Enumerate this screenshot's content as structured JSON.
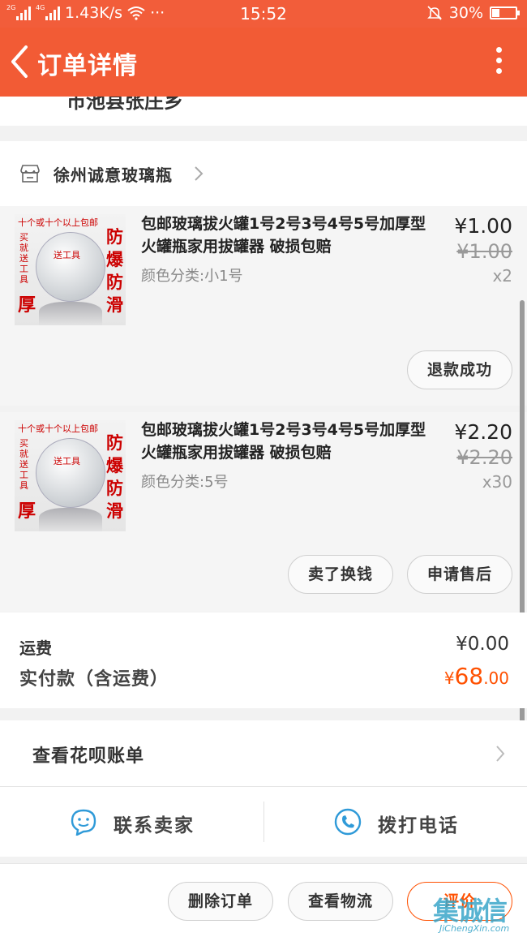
{
  "status_bar": {
    "network_2g": "2G",
    "network_4g": "4G",
    "speed": "1.43K/s",
    "dots": "···",
    "time": "15:52",
    "battery": "30%"
  },
  "header": {
    "title": "订单详情"
  },
  "address": {
    "partial_line": "市池县张庄乡"
  },
  "store": {
    "name": "徐州诚意玻璃瓶"
  },
  "items": [
    {
      "title": "包邮玻璃拔火罐1号2号3号4号5号加厚型火罐瓶家用拔罐器 破损包赔",
      "spec": "颜色分类:小1号",
      "price": "¥1.00",
      "original_price": "¥1.00",
      "quantity": "x2",
      "thumb": {
        "top": "十个或十个以上包邮",
        "left": "买就送工具",
        "mid": "送工具",
        "right": "防爆防滑",
        "bottom": "厚"
      },
      "actions": [
        "退款成功"
      ]
    },
    {
      "title": "包邮玻璃拔火罐1号2号3号4号5号加厚型火罐瓶家用拔罐器 破损包赔",
      "spec": "颜色分类:5号",
      "price": "¥2.20",
      "original_price": "¥2.20",
      "quantity": "x30",
      "thumb": {
        "top": "十个或十个以上包邮",
        "left": "买就送工具",
        "mid": "送工具",
        "right": "防爆防滑",
        "bottom": "厚"
      },
      "actions": [
        "卖了换钱",
        "申请售后"
      ]
    }
  ],
  "totals": {
    "shipping_label": "运费",
    "shipping_value": "¥0.00",
    "paid_label": "实付款（含运费）",
    "paid_symbol": "¥",
    "paid_integer": "68",
    "paid_cents": ".00",
    "paid_color": "#ff5000"
  },
  "huabei": {
    "label": "查看花呗账单"
  },
  "contact": {
    "seller_label": "联系卖家",
    "phone_label": "拨打电话",
    "icon_color": "#2f9ad8"
  },
  "bottom_bar": {
    "delete": "删除订单",
    "logistics": "查看物流",
    "review": "评价"
  },
  "watermark": {
    "main": "集诚信",
    "sub": "JiChengXin.com"
  },
  "colors": {
    "brand": "#f25b35",
    "accent": "#ff5000"
  }
}
